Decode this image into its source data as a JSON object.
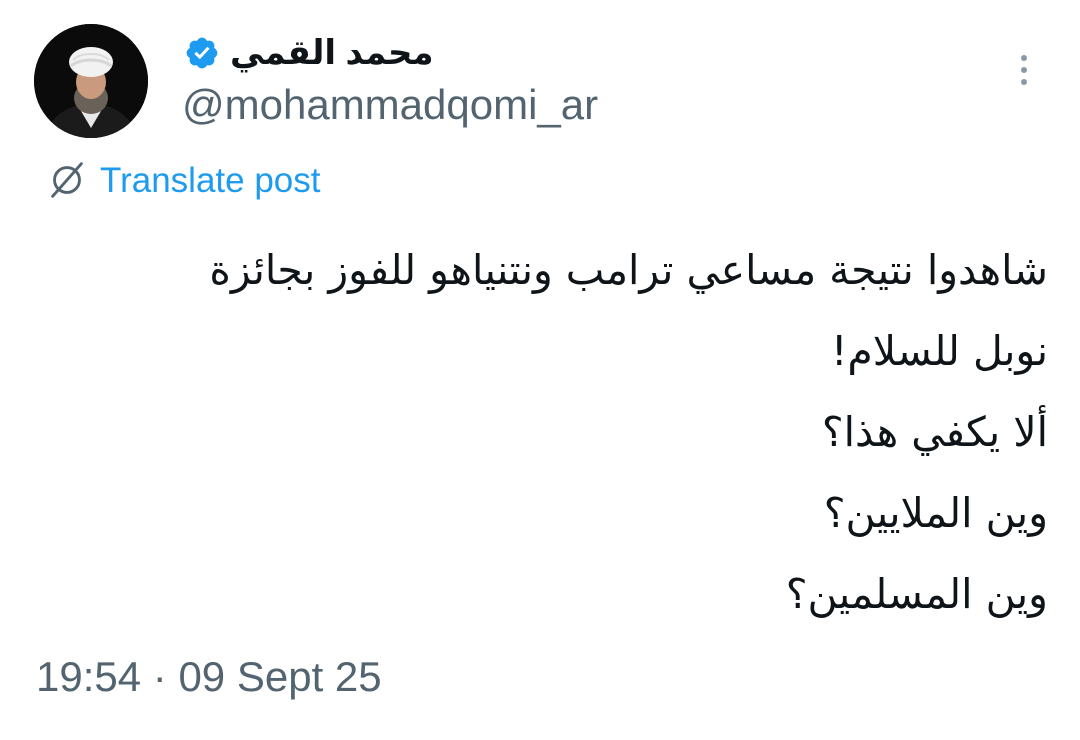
{
  "author": {
    "display_name": "محمد القمي",
    "handle": "@mohammadqomi_ar",
    "verified": true,
    "avatar_icon": "profile-photo"
  },
  "header": {
    "more_icon": "more-vertical-icon"
  },
  "translate": {
    "label": "Translate post",
    "icon": "translate-globe-icon",
    "color": "#1d9bf0"
  },
  "post": {
    "lines": [
      "شاهدوا نتيجة مساعي ترامب ونتنياهو للفوز بجائزة",
      "نوبل للسلام!",
      "ألا يكفي هذا؟",
      "وين الملايين؟",
      "وين المسلمين؟"
    ]
  },
  "meta": {
    "time": "19:54",
    "separator": "·",
    "date": "09 Sept 25"
  },
  "colors": {
    "text": "#0f1419",
    "secondary": "#536471",
    "accent": "#1d9bf0",
    "verified": "#1d9bf0"
  }
}
